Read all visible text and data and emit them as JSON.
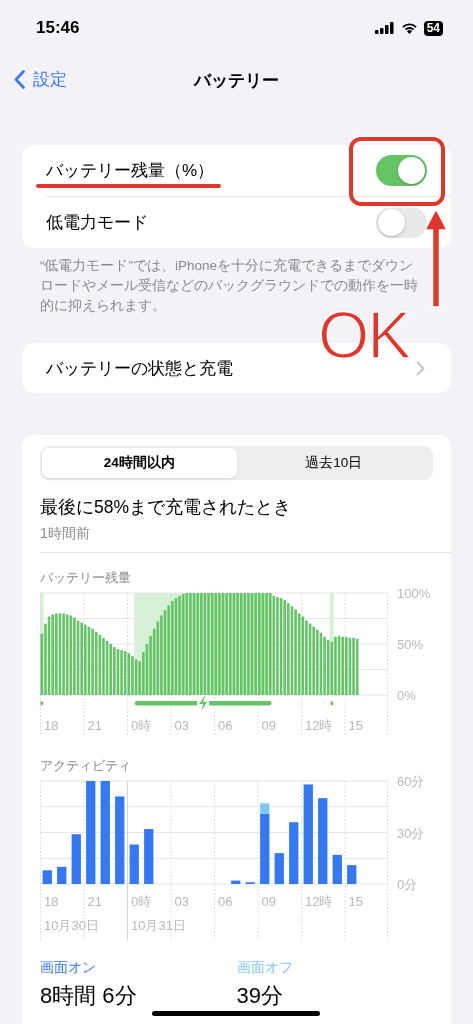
{
  "status_bar": {
    "time": "15:46",
    "battery": "54"
  },
  "nav": {
    "back": "設定",
    "title": "バッテリー"
  },
  "settings": [
    {
      "kind": "toggle",
      "label": "バッテリー残量（%）",
      "on": true
    },
    {
      "kind": "toggle",
      "label": "低電力モード",
      "on": false
    }
  ],
  "settings_footer": "“低電力モード”では、iPhoneを十分に充電できるまでダウンロードやメール受信などのバックグラウンドでの動作を一時的に抑えられます。",
  "health_link": {
    "label": "バッテリーの状態と充電"
  },
  "callout": {
    "text": "OK"
  },
  "usage": {
    "tabs": [
      {
        "label": "24時間以内",
        "selected": true
      },
      {
        "label": "過去10日",
        "selected": false
      }
    ],
    "heading": "最後に58%まで充電されたとき",
    "subheading": "1時間前",
    "battery_chart": {
      "chart_data": {
        "type": "bar",
        "title": "バッテリー残量",
        "values": [
          60,
          70,
          77,
          79,
          80,
          80,
          80,
          79,
          78,
          76,
          73,
          71,
          69,
          67,
          65,
          62,
          59,
          56,
          53,
          50,
          47,
          45,
          44,
          43,
          41,
          38,
          35,
          33,
          42,
          50,
          58,
          65,
          72,
          78,
          83,
          88,
          92,
          95,
          97,
          99,
          100,
          100,
          100,
          100,
          100,
          100,
          100,
          100,
          100,
          100,
          100,
          100,
          100,
          100,
          100,
          100,
          100,
          100,
          100,
          100,
          100,
          100,
          100,
          100,
          97,
          96,
          95,
          93,
          90,
          87,
          84,
          80,
          77,
          73,
          70,
          67,
          64,
          61,
          57,
          54,
          52,
          57,
          58,
          57,
          57,
          56,
          56,
          55,
          null,
          null,
          null,
          null,
          null,
          null,
          null,
          null
        ],
        "ylim": [
          0,
          100
        ],
        "yticks": [
          {
            "value": 0,
            "label": "0%"
          },
          {
            "value": 50,
            "label": "50%"
          },
          {
            "value": 100,
            "label": "100%"
          }
        ]
      },
      "hour_labels": [
        "18",
        "21",
        "0時",
        "03",
        "06",
        "09",
        "12時",
        "15"
      ]
    },
    "activity_chart": {
      "chart_data": {
        "type": "bar",
        "title": "アクティビティ",
        "stacked": true,
        "series": [
          {
            "name": "画面オン",
            "color": "#3478f6",
            "values": [
              8,
              10,
              29,
              60,
              60,
              51,
              23,
              32,
              0,
              0,
              0,
              0,
              0,
              2,
              1,
              41,
              18,
              36,
              58,
              50,
              17,
              11,
              null,
              null
            ]
          },
          {
            "name": "画面オフ",
            "color": "#7fc7f9",
            "values": [
              0,
              0,
              0,
              0,
              0,
              0,
              0,
              0,
              0,
              0,
              0,
              0,
              0,
              0,
              0,
              6,
              0,
              0,
              0,
              0,
              0,
              0,
              null,
              null
            ]
          }
        ],
        "ylim": [
          0,
          60
        ],
        "yticks": [
          {
            "value": 0,
            "label": "0分"
          },
          {
            "value": 30,
            "label": "30分"
          },
          {
            "value": 60,
            "label": "60分"
          }
        ]
      },
      "hour_labels": [
        "18",
        "21",
        "0時",
        "03",
        "06",
        "09",
        "12時",
        "15"
      ],
      "date_labels": [
        "10月30日",
        "10月31日"
      ]
    },
    "stats": [
      {
        "value": "8時間 6分"
      },
      {
        "value": "39分"
      }
    ]
  }
}
